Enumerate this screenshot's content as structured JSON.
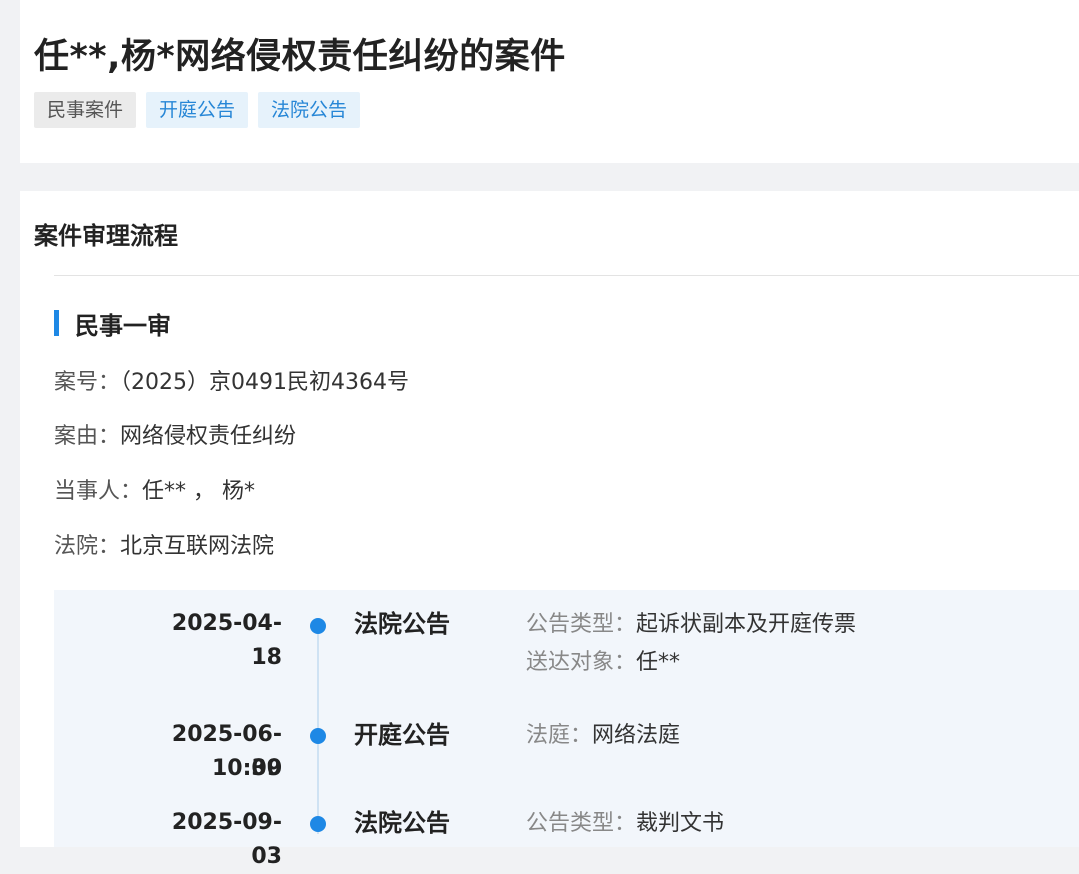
{
  "header": {
    "title": "任**,杨*网络侵权责任纠纷的案件",
    "tags": [
      "民事案件",
      "开庭公告",
      "法院公告"
    ]
  },
  "process": {
    "section_title": "案件审理流程",
    "stage_title": "民事一审",
    "info": [
      {
        "label": "案号：",
        "value": "（2025）京0491民初4364号"
      },
      {
        "label": "案由：",
        "value": "网络侵权责任纠纷"
      },
      {
        "label": "当事人：",
        "value": "任** ， 杨*"
      },
      {
        "label": "法院：",
        "value": "北京互联网法院"
      }
    ]
  },
  "timeline": [
    {
      "date": "2025-04-18",
      "time": "",
      "type": "法院公告",
      "details": [
        {
          "label": "公告类型：",
          "value": "起诉状副本及开庭传票"
        },
        {
          "label": "送达对象：",
          "value": "任**"
        }
      ]
    },
    {
      "date": "2025-06-09",
      "time": "10:30",
      "type": "开庭公告",
      "details": [
        {
          "label": "法庭：",
          "value": "网络法庭"
        }
      ]
    },
    {
      "date": "2025-09-03",
      "time": "",
      "type": "法院公告",
      "details": [
        {
          "label": "公告类型：",
          "value": "裁判文书"
        }
      ]
    }
  ],
  "colors": {
    "accent": "#1e88e5",
    "tag_blue_bg": "#e6f2fb",
    "tag_gray_bg": "#ebebeb",
    "timeline_bg": "#f2f6fb"
  }
}
